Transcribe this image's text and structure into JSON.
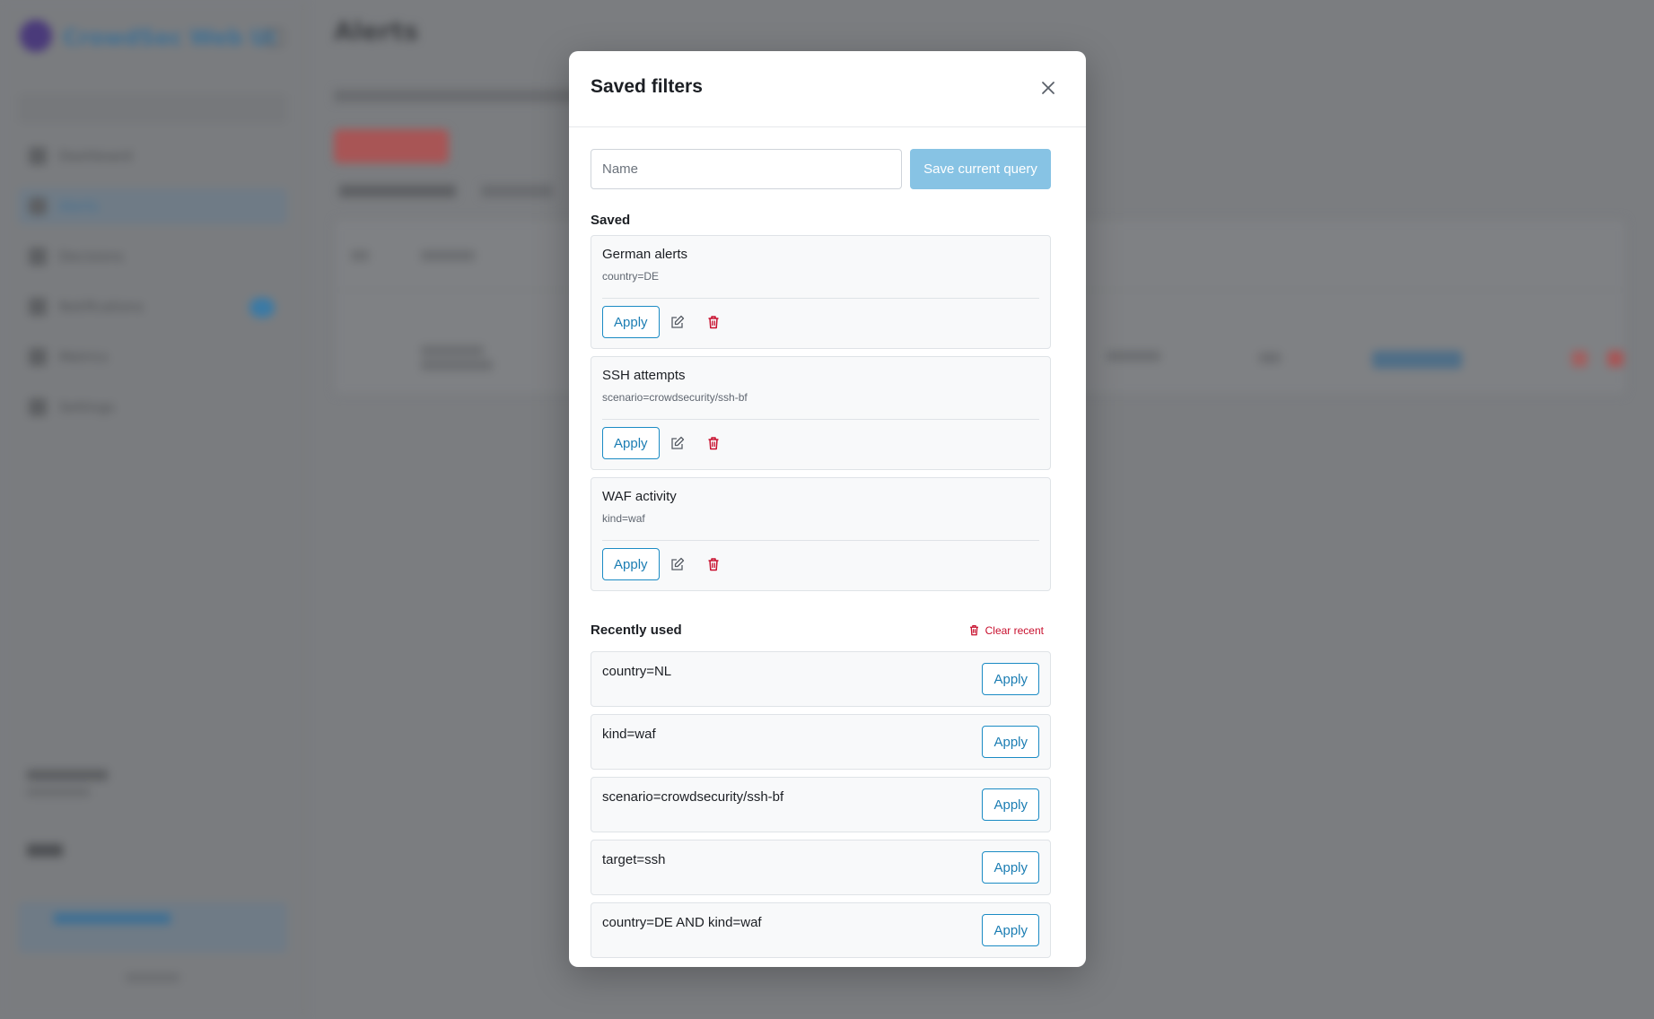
{
  "background": {
    "brand": "CrowdSec Web UI",
    "page_title": "Alerts",
    "nav_items": [
      "Dashboard",
      "Alerts",
      "Decisions",
      "Notifications",
      "Metrics",
      "Settings"
    ]
  },
  "modal": {
    "title": "Saved filters",
    "name_placeholder": "Name",
    "save_button": "Save current query",
    "saved_label": "Saved",
    "saved": [
      {
        "name": "German alerts",
        "query": "country=DE"
      },
      {
        "name": "SSH attempts",
        "query": "scenario=crowdsecurity/ssh-bf"
      },
      {
        "name": "WAF activity",
        "query": "kind=waf"
      }
    ],
    "apply_label": "Apply",
    "recent_label": "Recently used",
    "clear_recent_label": "Clear recent",
    "recent": [
      "country=NL",
      "kind=waf",
      "scenario=crowdsecurity/ssh-bf",
      "target=ssh",
      "country=DE AND kind=waf"
    ]
  },
  "colors": {
    "primary": "#1b7db3",
    "save_button_disabled": "#87c3e4",
    "danger": "#c8102e"
  },
  "icons": {
    "close": "close-icon",
    "edit": "edit-icon",
    "delete": "trash-icon"
  }
}
